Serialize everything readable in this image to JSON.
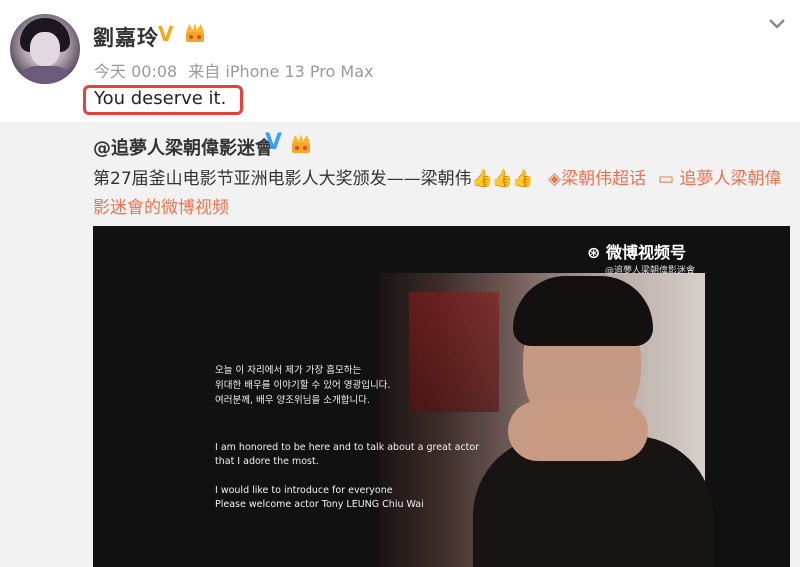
{
  "post": {
    "author": "劉嘉玲",
    "verified_badge": "V",
    "crown_icon": "crown-icon",
    "meta": {
      "time": "今天 00:08",
      "source": "来自 iPhone 13 Pro Max"
    },
    "text": "You deserve it."
  },
  "repost": {
    "author": "@追夢人梁朝偉影迷會",
    "verified_badge": "V",
    "text_line1": "第27届釜山电影节亚洲电影人大奖颁发——梁朝伟",
    "thumbs": "👍👍👍",
    "topic": "梁朝伟超话",
    "video_source_prefix": "追夢人梁朝偉",
    "text_line2": "影迷會的微博视频"
  },
  "video": {
    "watermark_logo": "微博视频号",
    "watermark_sub": "@追夢人梁朝偉影迷會",
    "subtitle_kr": [
      "오늘 이 자리에서 제가 가장 흠모하는",
      "위대한 배우를 이야기할 수 있어 영광입니다.",
      "여러분께, 배우 양조위님을 소개합니다."
    ],
    "subtitle_en": [
      "I am honored to be here and to talk about a great actor",
      "that I adore the most."
    ],
    "subtitle_en2": [
      "I would like to introduce for everyone",
      "Please welcome actor Tony LEUNG Chiu Wai"
    ]
  },
  "colors": {
    "highlight_box": "#e8403b",
    "link": "#eb7350",
    "verified_blue": "#3aa0ef",
    "verified_gold": "#f5a623"
  }
}
